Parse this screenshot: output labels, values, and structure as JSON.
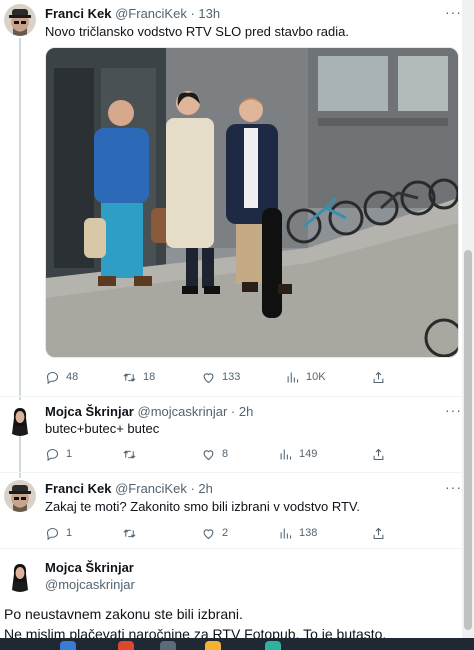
{
  "tweets": [
    {
      "name": "Franci Kek",
      "handle": "@FranciKek",
      "time": "13h",
      "text": "Novo tričlansko vodstvo RTV SLO pred stavbo radia.",
      "replies": "48",
      "retweets": "18",
      "likes": "133",
      "views": "10K"
    },
    {
      "name": "Mojca Škrinjar",
      "handle": "@mojcaskrinjar",
      "time": "2h",
      "text": "butec+butec+ butec",
      "replies": "1",
      "retweets": "",
      "likes": "8",
      "views": "149"
    },
    {
      "name": "Franci Kek",
      "handle": "@FranciKek",
      "time": "2h",
      "text": "Zakaj te moti? Zakonito smo bili izbrani v vodstvo RTV.",
      "replies": "1",
      "retweets": "",
      "likes": "2",
      "views": "138"
    }
  ],
  "focused": {
    "name": "Mojca Škrinjar",
    "handle": "@mojcaskrinjar",
    "line1": "Po neustavnem zakonu ste bili izbrani.",
    "line2": "Ne mislim plačevati naročnine za RTV Fotopub. To je butasto."
  },
  "separators": {
    "dot": "·",
    "more": "···"
  },
  "icons": [
    "reply-icon",
    "retweet-icon",
    "like-icon",
    "views-icon",
    "share-icon"
  ],
  "colors": {
    "text": "#0f1419",
    "muted": "#536471",
    "thread_line": "#cfd9de"
  }
}
